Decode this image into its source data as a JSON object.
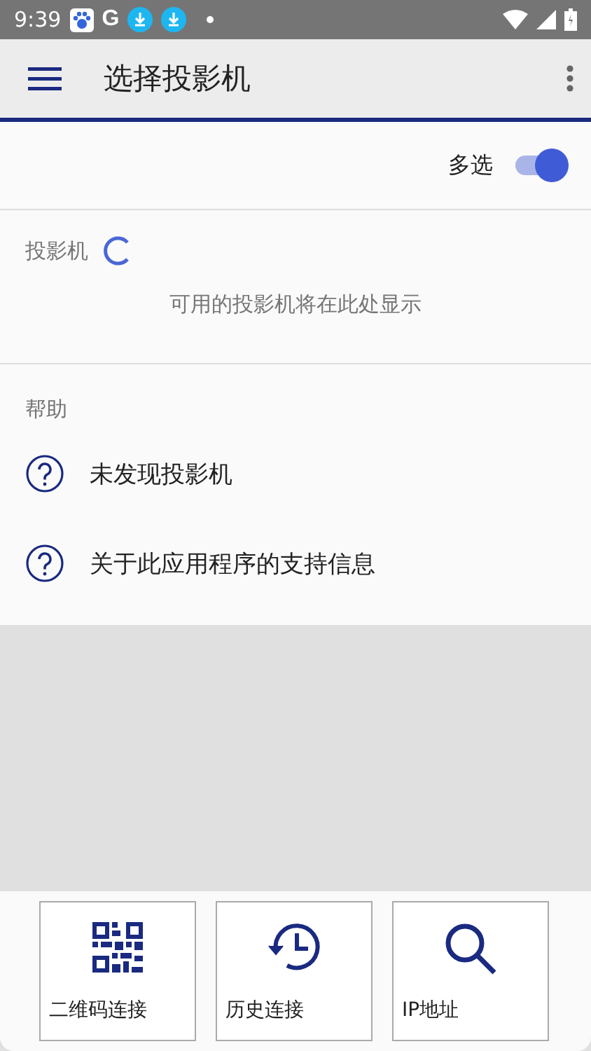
{
  "status_bar": {
    "time": "9:39",
    "google_letter": "G"
  },
  "app_bar": {
    "title": "选择投影机"
  },
  "multi_select": {
    "label": "多选",
    "on": true
  },
  "projectors": {
    "header": "投影机",
    "loading": true,
    "empty_text": "可用的投影机将在此处显示"
  },
  "help": {
    "header": "帮助",
    "items": [
      {
        "label": "未发现投影机"
      },
      {
        "label": "关于此应用程序的支持信息"
      }
    ]
  },
  "actions": [
    {
      "kind": "qr",
      "label": "二维码连接"
    },
    {
      "kind": "history",
      "label": "历史连接"
    },
    {
      "kind": "search",
      "label": "IP地址"
    }
  ]
}
